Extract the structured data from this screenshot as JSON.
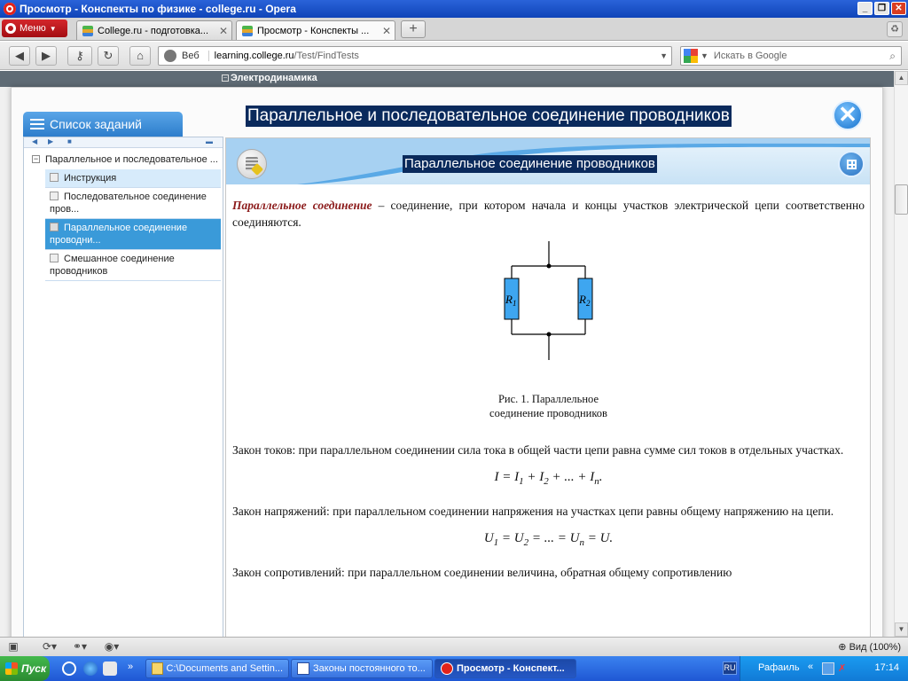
{
  "window": {
    "title": "Просмотр - Конспекты по физике - college.ru - Opera"
  },
  "tabs": {
    "menu_label": "Меню",
    "items": [
      {
        "label": "College.ru - подготовка..."
      },
      {
        "label": "Просмотр - Конспекты ..."
      }
    ],
    "new_tab_label": "+"
  },
  "navbar": {
    "address_label": "Веб",
    "url_host": "learning.college.ru",
    "url_path": "/Test/FindTests",
    "search_placeholder": "Искать в Google"
  },
  "site": {
    "section_label": "Электродинамика"
  },
  "modal": {
    "title": "Параллельное и последовательное соединение проводников",
    "tasks_header": "Список заданий",
    "tree_root": "Параллельное и последовательное ...",
    "tree_items": [
      {
        "label": "Инструкция"
      },
      {
        "label": "Последовательное соединение пров..."
      },
      {
        "label": "Параллельное соединение проводни..."
      },
      {
        "label": "Смешанное соединение проводников"
      }
    ]
  },
  "content": {
    "title": "Параллельное соединение проводников",
    "term": "Параллельное соединение",
    "definition": " – соединение, при котором начала и концы участков электрической цепи соответственно соединяются.",
    "figure": {
      "r1": "R",
      "r1_sub": "1",
      "r2": "R",
      "r2_sub": "2",
      "caption_line1": "Рис. 1. Параллельное",
      "caption_line2": "соединение проводников"
    },
    "current_law": "Закон токов: при параллельном соединении сила тока в общей части цепи равна сумме сил токов в отдельных участках.",
    "current_formula": {
      "a": "I = I",
      "s1": "1",
      "b": " + I",
      "s2": "2",
      "c": " + ... + I",
      "sn": "n",
      "d": "."
    },
    "voltage_law": "Закон напряжений: при параллельном соединении напряжения на участках цепи равны общему напряжению на цепи.",
    "voltage_formula": {
      "a": "U",
      "s1": "1",
      "b": " = U",
      "s2": "2",
      "c": " = ... = U",
      "sn": "n",
      "d": " = U."
    },
    "resistance_law": "Закон сопротивлений: при параллельном соединении величина, обратная общему сопротивлению"
  },
  "statusbar": {
    "zoom": "Вид (100%)"
  },
  "taskbar": {
    "start": "Пуск",
    "items": [
      {
        "label": "C:\\Documents and Settin..."
      },
      {
        "label": "Законы постоянного то..."
      },
      {
        "label": "Просмотр - Конспект..."
      }
    ],
    "lang": "RU",
    "user": "Рафаиль",
    "time": "17:14"
  },
  "colors": {
    "title_highlight": "#0a2a5c",
    "term": "#8b1a1a",
    "resistor_fill": "#3ea6f0",
    "selected_item": "#3a9ad9"
  }
}
